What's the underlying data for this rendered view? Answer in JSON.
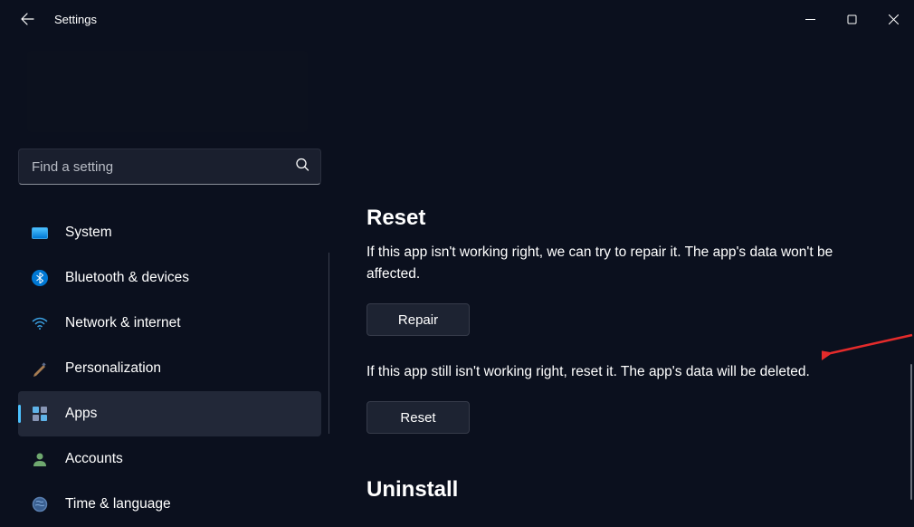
{
  "titlebar": {
    "app_title": "Settings"
  },
  "search": {
    "placeholder": "Find a setting"
  },
  "sidebar": {
    "items": [
      {
        "label": "System",
        "icon": "system-icon",
        "active": false
      },
      {
        "label": "Bluetooth & devices",
        "icon": "bluetooth-icon",
        "active": false
      },
      {
        "label": "Network & internet",
        "icon": "network-icon",
        "active": false
      },
      {
        "label": "Personalization",
        "icon": "personalization-icon",
        "active": false
      },
      {
        "label": "Apps",
        "icon": "apps-icon",
        "active": true
      },
      {
        "label": "Accounts",
        "icon": "accounts-icon",
        "active": false
      },
      {
        "label": "Time & language",
        "icon": "time-icon",
        "active": false
      }
    ]
  },
  "main": {
    "reset": {
      "title": "Reset",
      "repair_desc": "If this app isn't working right, we can try to repair it. The app's data won't be affected.",
      "repair_button": "Repair",
      "reset_desc": "If this app still isn't working right, reset it. The app's data will be deleted.",
      "reset_button": "Reset"
    },
    "uninstall": {
      "title": "Uninstall"
    }
  }
}
